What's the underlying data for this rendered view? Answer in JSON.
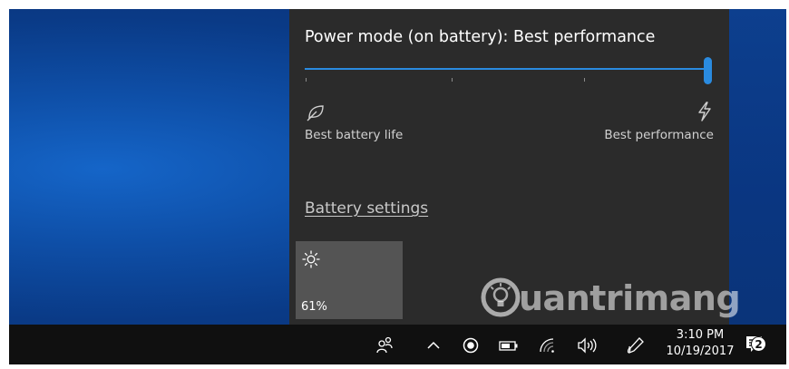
{
  "power": {
    "title": "Power mode (on battery): Best performance",
    "level": 1.0,
    "left_label": "Best battery life",
    "right_label": "Best performance",
    "left_icon": "leaf-icon",
    "right_icon": "lightning-bolt-icon"
  },
  "battery_settings_link": "Battery settings",
  "brightness_tile": {
    "icon": "sun-icon",
    "value": "61%"
  },
  "watermark": {
    "text": "uantrimang",
    "logo_icon": "lightbulb-icon"
  },
  "taskbar": {
    "icons": [
      "people-icon",
      "chevron-up-icon",
      "record-icon",
      "battery-icon",
      "wifi-icon",
      "volume-icon",
      "pen-icon",
      "action-center-icon"
    ],
    "time": "3:10 PM",
    "date": "10/19/2017",
    "notification_count": "2"
  },
  "colors": {
    "accent": "#2a8be0",
    "flyout_bg": "#2b2b2b",
    "tile_bg": "#545454",
    "taskbar_bg": "#101010"
  }
}
